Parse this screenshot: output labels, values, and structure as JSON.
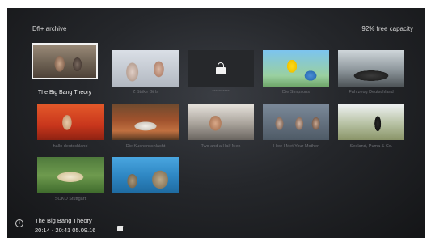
{
  "header": {
    "title": "Dfl+ archive",
    "capacity": "92% free capacity"
  },
  "grid": {
    "items": [
      {
        "title": "The Big Bang Theory",
        "focused": true
      },
      {
        "title": "Z Strike Girls",
        "focused": false
      },
      {
        "title": "**********",
        "focused": false,
        "locked": true
      },
      {
        "title": "Die Simpsons",
        "focused": false
      },
      {
        "title": "Fahrzeug Deutschland",
        "focused": false
      },
      {
        "title": "hallo deutschland",
        "focused": false
      },
      {
        "title": "Die Kuchenschlacht",
        "focused": false
      },
      {
        "title": "Two and a Half Men",
        "focused": false
      },
      {
        "title": "How I Met Your Mother",
        "focused": false
      },
      {
        "title": "Seeland, Puma & Co.",
        "focused": false
      },
      {
        "title": "SOKO Stuttgart",
        "focused": false
      },
      {
        "title": "",
        "focused": false
      }
    ]
  },
  "footer": {
    "title": "The Big Bang Theory",
    "time": "20:14 - 20:41  05.09.16",
    "info_icon": "info-icon",
    "media_icon": "clapperboard-icon"
  }
}
